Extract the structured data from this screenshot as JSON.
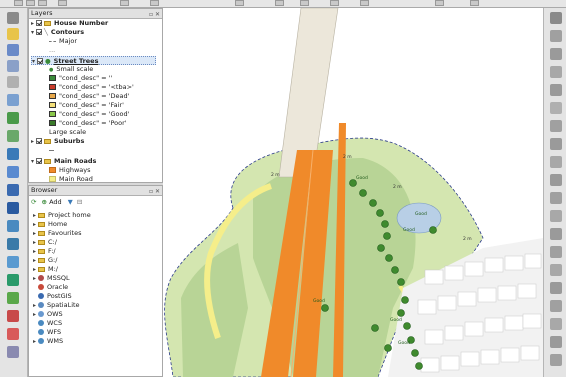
{
  "layers_panel": {
    "title": "Layers",
    "items": [
      {
        "label": "House Number"
      },
      {
        "label": "Contours"
      },
      {
        "label": "Major"
      },
      {
        "label": "..."
      },
      {
        "label": "Street Trees"
      },
      {
        "label": "Small scale"
      },
      {
        "label": "\"cond_desc\" = ''"
      },
      {
        "label": "\"cond_desc\" = '<tba>'"
      },
      {
        "label": "\"cond_desc\" = 'Dead'"
      },
      {
        "label": "\"cond_desc\" = 'Fair'"
      },
      {
        "label": "\"cond_desc\" = 'Good'"
      },
      {
        "label": "\"cond_desc\" = 'Poor'"
      },
      {
        "label": "Large scale"
      },
      {
        "label": "Suburbs"
      },
      {
        "label": "Main Roads"
      },
      {
        "label": "Highways"
      },
      {
        "label": "Main Road"
      }
    ]
  },
  "browser_panel": {
    "title": "Browser",
    "add_label": "Add",
    "items": [
      {
        "label": "Project home"
      },
      {
        "label": "Home"
      },
      {
        "label": "Favourites"
      },
      {
        "label": "C:/"
      },
      {
        "label": "F:/"
      },
      {
        "label": "G:/"
      },
      {
        "label": "M:/"
      },
      {
        "label": "MSSQL"
      },
      {
        "label": "Oracle"
      },
      {
        "label": "PostGIS"
      },
      {
        "label": "SpatiaLite"
      },
      {
        "label": "OWS"
      },
      {
        "label": "WCS"
      },
      {
        "label": "WFS"
      },
      {
        "label": "WMS"
      }
    ]
  },
  "map_labels": {
    "tree_label": "Good",
    "road_label": "2 m"
  },
  "colors": {
    "land": "#d4e6b0",
    "park": "#b8d496",
    "highway": "#f08a2a",
    "bridge": "#ece7da",
    "yellow_road": "#f5ee8a",
    "tree": "#3f8a2e",
    "water": "#b8cfe6",
    "boundary": "#2a3a8a"
  }
}
